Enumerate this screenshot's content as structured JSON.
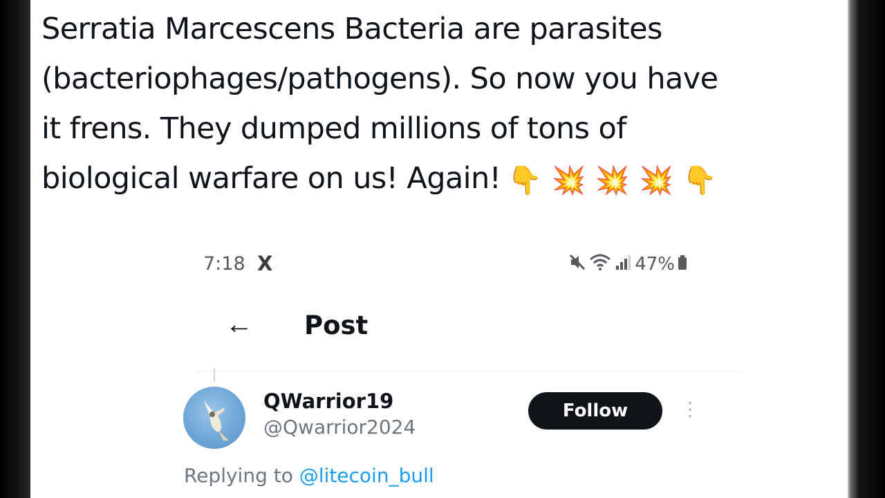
{
  "tweet": {
    "lines": [
      "Serratia Marcescens Bacteria are parasites",
      "(bacteriophages/pathogens). So now you have",
      "it frens. They dumped millions of tons of",
      "biological warfare on us! Again!"
    ],
    "emojis": [
      {
        "icon": "backhand-index-pointing-down-icon",
        "glyph": "👇"
      },
      {
        "icon": "collision-icon",
        "glyph": "💥"
      },
      {
        "icon": "collision-icon",
        "glyph": "💥"
      },
      {
        "icon": "collision-icon",
        "glyph": "💥"
      },
      {
        "icon": "backhand-index-pointing-down-icon",
        "glyph": "👇"
      }
    ]
  },
  "status_bar": {
    "time": "7:18",
    "app_logo": "X",
    "battery": "47%"
  },
  "post_header": {
    "back_icon": "←",
    "title": "Post"
  },
  "author": {
    "name": "QWarrior19",
    "handle": "@Qwarrior2024"
  },
  "follow_button": {
    "label": "Follow"
  },
  "more_icon": "⋮",
  "replying": {
    "prefix": "Replying to ",
    "mention": "@litecoin_bull"
  },
  "colors": {
    "text": "#0f1419",
    "secondary": "#6e767d",
    "link": "#1d9bf0",
    "follow_bg": "#0f1419"
  }
}
